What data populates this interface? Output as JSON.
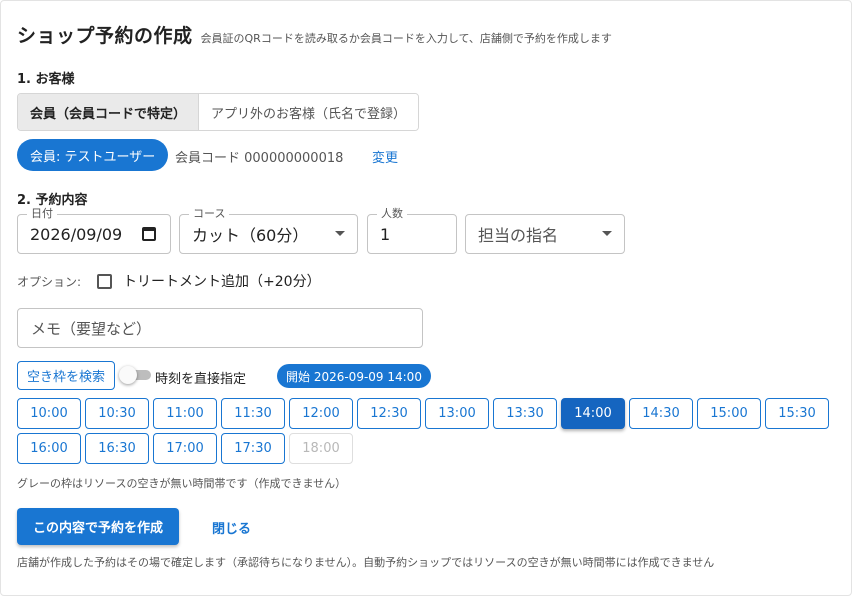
{
  "header": {
    "title": "ショップ予約の作成",
    "subtitle": "会員証のQRコードを読み取るか会員コードを入力して、店舗側で予約を作成します"
  },
  "customer": {
    "section_label": "1. お客様",
    "mode_member": "会員（会員コードで特定）",
    "mode_guest": "アプリ外のお客様（氏名で登録）",
    "member_chip": "会員: テストユーザー",
    "member_code_text": "会員コード 000000000018",
    "change_label": "変更"
  },
  "booking": {
    "section_label": "2. 予約内容",
    "date_label": "日付",
    "date_value": "2026/09/09",
    "course_label": "コース",
    "course_value": "カット（60分）",
    "people_label": "人数",
    "people_value": "1",
    "staff_placeholder": "担当の指名",
    "options_label": "オプション:",
    "treatment_label": "トリートメント追加（+20分）",
    "memo_placeholder": "メモ（要望など）",
    "search_button": "空き枠を検索",
    "direct_time_label": "時刻を直接指定",
    "start_chip": "開始 2026-09-09 14:00"
  },
  "slots": [
    {
      "time": "10:00",
      "state": "available"
    },
    {
      "time": "10:30",
      "state": "available"
    },
    {
      "time": "11:00",
      "state": "available"
    },
    {
      "time": "11:30",
      "state": "available"
    },
    {
      "time": "12:00",
      "state": "available"
    },
    {
      "time": "12:30",
      "state": "available"
    },
    {
      "time": "13:00",
      "state": "available"
    },
    {
      "time": "13:30",
      "state": "available"
    },
    {
      "time": "14:00",
      "state": "selected"
    },
    {
      "time": "14:30",
      "state": "available"
    },
    {
      "time": "15:00",
      "state": "available"
    },
    {
      "time": "15:30",
      "state": "available"
    },
    {
      "time": "16:00",
      "state": "available"
    },
    {
      "time": "16:30",
      "state": "available"
    },
    {
      "time": "17:00",
      "state": "available"
    },
    {
      "time": "17:30",
      "state": "available"
    },
    {
      "time": "18:00",
      "state": "disabled"
    }
  ],
  "notes": {
    "grey_note": "グレーの枠はリソースの空きが無い時間帯です（作成できません）",
    "footer_note": "店舗が作成した予約はその場で確定します（承認待ちになりません）。自動予約ショップではリソースの空きが無い時間帯には作成できません"
  },
  "actions": {
    "create_label": "この内容で予約を作成",
    "close_label": "閉じる"
  },
  "colors": {
    "primary": "#1976d2",
    "selected": "#1565c0",
    "disabled": "#b8b8b8"
  }
}
